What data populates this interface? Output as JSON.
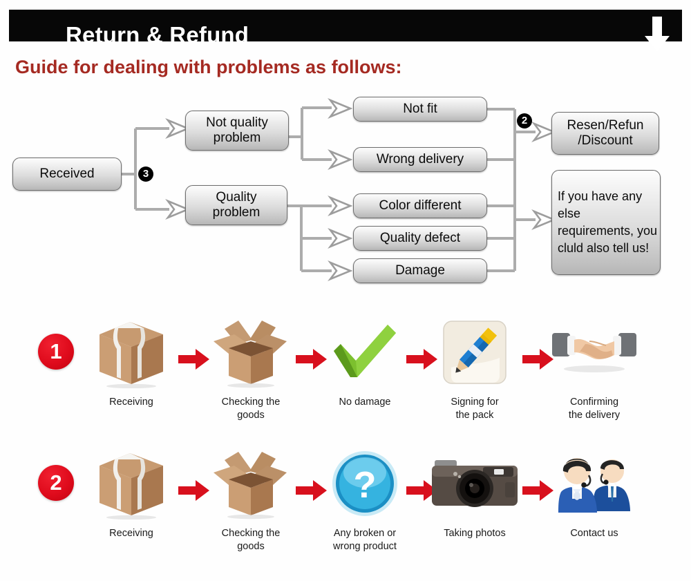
{
  "header": {
    "title": "Return & Refund",
    "arrow_icon": "down-arrow-icon",
    "bar_color": "#070707"
  },
  "guide": {
    "heading": "Guide for dealing with problems as follows:",
    "heading_color": "#a52a22"
  },
  "flowchart": {
    "start": {
      "label": "Received"
    },
    "badges": {
      "branch": "3",
      "merge": "2"
    },
    "branches": [
      {
        "label": "Not quality\nproblem",
        "line1": "Not quality",
        "line2": "problem"
      },
      {
        "label": "Quality\nproblem",
        "line1": "Quality",
        "line2": "problem"
      }
    ],
    "issues": [
      {
        "label": "Not fit"
      },
      {
        "label": "Wrong delivery"
      },
      {
        "label": "Color different"
      },
      {
        "label": "Quality defect"
      },
      {
        "label": "Damage"
      }
    ],
    "outcomes": [
      {
        "line1": "Resen/Refun",
        "line2": "/Discount"
      },
      {
        "text": "If you have any else requirements, you cluld also tell us!"
      }
    ]
  },
  "process": {
    "rows": [
      {
        "number": "1",
        "steps": [
          {
            "icon": "sealed-box-icon",
            "label_line1": "Receiving",
            "label_line2": ""
          },
          {
            "icon": "open-box-icon",
            "label_line1": "Checking the",
            "label_line2": "goods"
          },
          {
            "icon": "green-check-icon",
            "label_line1": "No damage",
            "label_line2": ""
          },
          {
            "icon": "pencil-signing-icon",
            "label_line1": "Signing for",
            "label_line2": "the pack"
          },
          {
            "icon": "handshake-icon",
            "label_line1": "Confirming",
            "label_line2": "the delivery"
          }
        ]
      },
      {
        "number": "2",
        "steps": [
          {
            "icon": "sealed-box-icon",
            "label_line1": "Receiving",
            "label_line2": ""
          },
          {
            "icon": "open-box-icon",
            "label_line1": "Checking the",
            "label_line2": "goods"
          },
          {
            "icon": "question-mark-icon",
            "label_line1": "Any broken or",
            "label_line2": "wrong product"
          },
          {
            "icon": "camera-icon",
            "label_line1": "Taking photos",
            "label_line2": ""
          },
          {
            "icon": "support-agents-icon",
            "label_line1": "Contact us",
            "label_line2": ""
          }
        ]
      }
    ],
    "arrow_icon": "red-right-arrow-icon",
    "arrow_color": "#d8101d",
    "number_badge_color": "#df0b1c"
  }
}
